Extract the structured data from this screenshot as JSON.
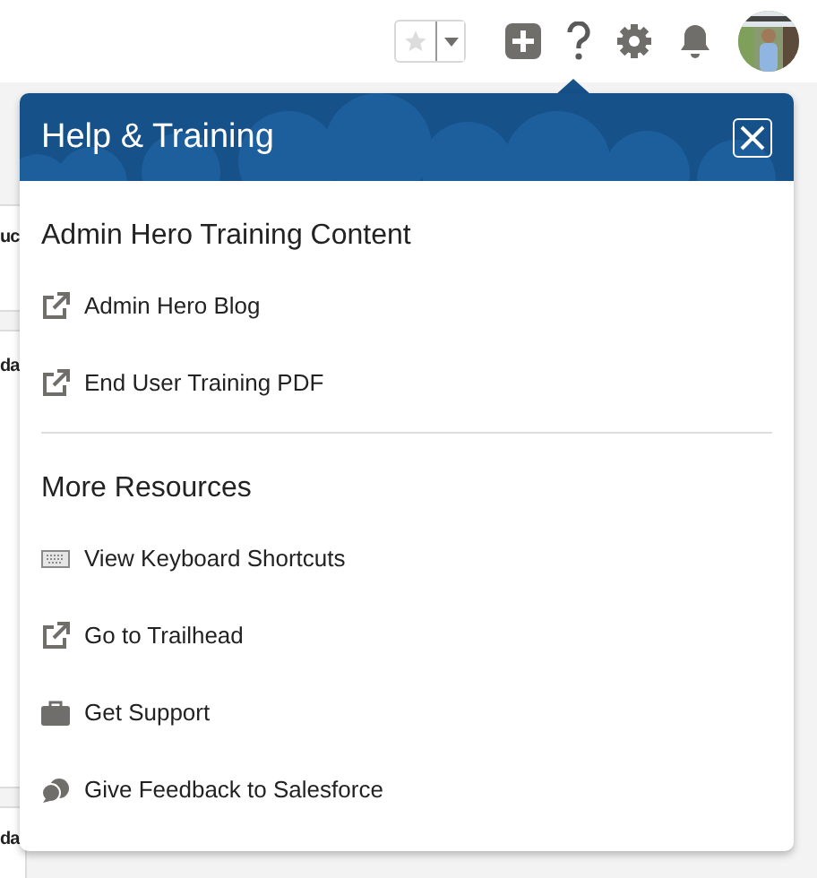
{
  "background_fragments": [
    "uc",
    "da",
    "da"
  ],
  "popover": {
    "title": "Help & Training",
    "sections": [
      {
        "heading": "Admin Hero Training Content",
        "items": [
          {
            "label": "Admin Hero Blog",
            "kind": "external"
          },
          {
            "label": "End User Training PDF",
            "kind": "external"
          }
        ]
      },
      {
        "heading": "More Resources",
        "items": [
          {
            "label": "View Keyboard Shortcuts",
            "kind": "keyboard"
          },
          {
            "label": "Go to Trailhead",
            "kind": "external"
          },
          {
            "label": "Get Support",
            "kind": "briefcase"
          },
          {
            "label": "Give Feedback to Salesforce",
            "kind": "feedback"
          }
        ]
      }
    ]
  }
}
